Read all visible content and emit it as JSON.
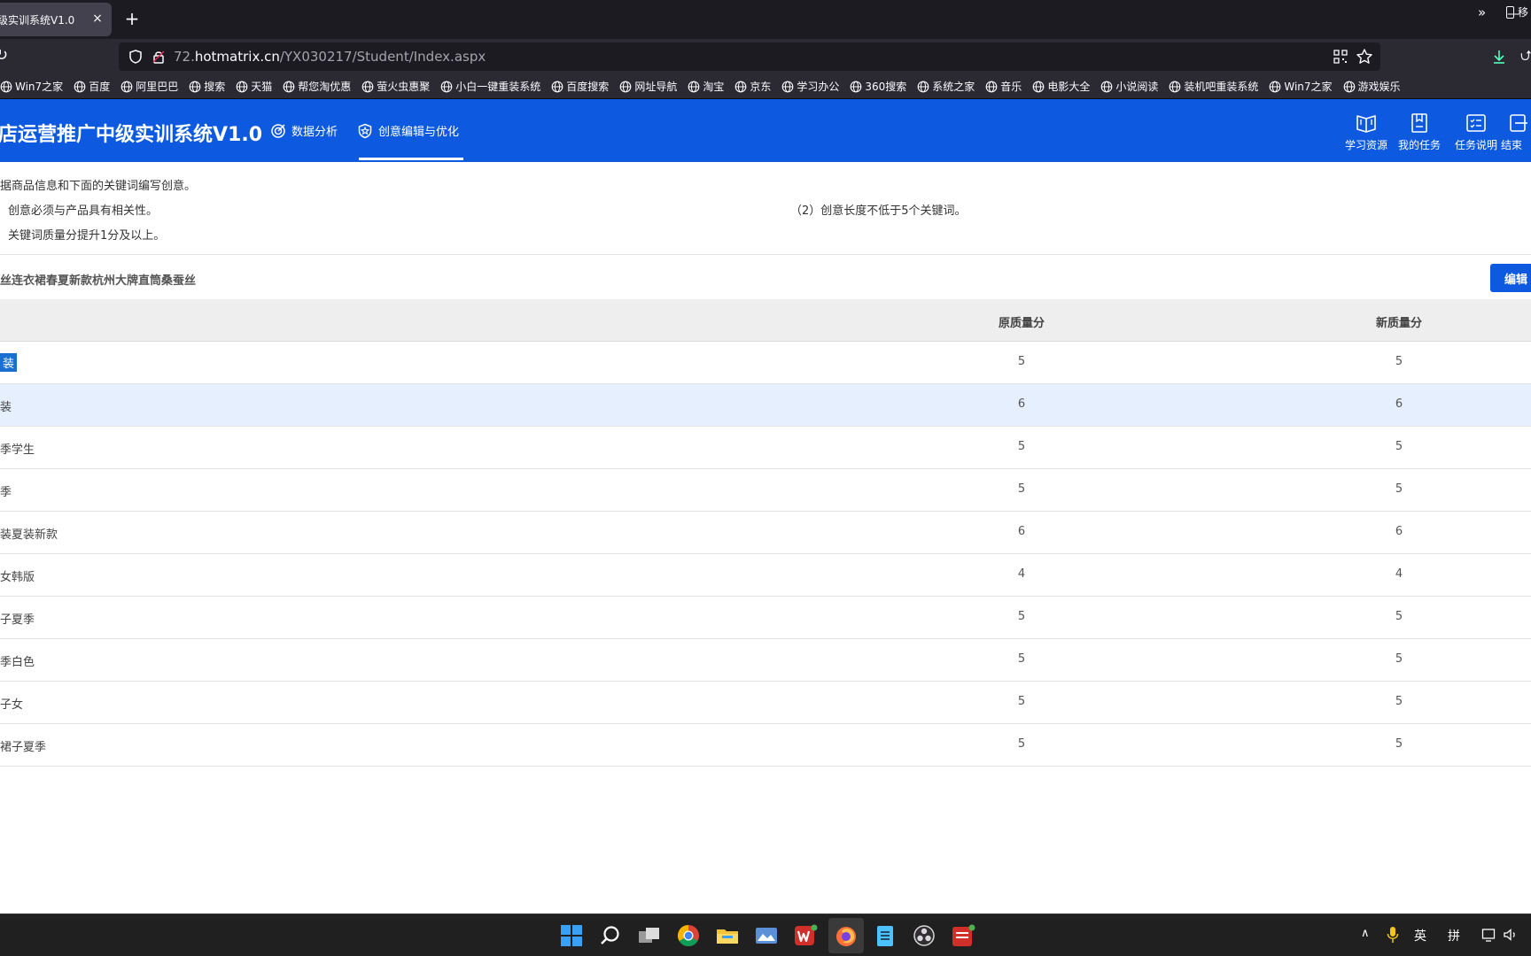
{
  "browser": {
    "tab_title": "级实训系统V1.0",
    "tab_close": "×",
    "new_tab": "+",
    "minimize": "—",
    "url_prefix": "72.",
    "url_host": "hotmatrix.cn",
    "url_path": "/YX030217/Student/Index.aspx",
    "bookmarks": [
      "Win7之家",
      "百度",
      "阿里巴巴",
      "搜索",
      "天猫",
      "帮您淘优惠",
      "萤火虫惠聚",
      "小白一键重装系统",
      "百度搜索",
      "网址导航",
      "淘宝",
      "京东",
      "学习办公",
      "360搜索",
      "系统之家",
      "音乐",
      "电影大全",
      "小说阅读",
      "装机吧重装系统",
      "Win7之家",
      "游戏娱乐"
    ],
    "bookmarks_more": "»",
    "mobile_bookmarks": "移"
  },
  "header": {
    "app_title": "店运营推广中级实训系统V1.0",
    "nav": [
      {
        "label": "数据分析"
      },
      {
        "label": "创意编辑与优化"
      }
    ],
    "right_icons": [
      {
        "label": "学习资源"
      },
      {
        "label": "我的任务"
      },
      {
        "label": "任务说明"
      },
      {
        "label": "结束"
      }
    ]
  },
  "instructions": {
    "line1": "据商品信息和下面的关键词编写创意。",
    "item1": "）创意必须与产品具有相关性。",
    "item2": "（2）创意长度不低于5个关键词。",
    "item3": "）关键词质量分提升1分及以上。"
  },
  "product": {
    "name": "丝连衣裙春夏新款杭州大牌直筒桑蚕丝",
    "edit_label": "编辑"
  },
  "table": {
    "headers": {
      "original": "原质量分",
      "new": "新质量分"
    },
    "rows": [
      {
        "keyword": "装",
        "original": "5",
        "new": "5"
      },
      {
        "keyword": "装",
        "original": "6",
        "new": "6"
      },
      {
        "keyword": "季学生",
        "original": "5",
        "new": "5"
      },
      {
        "keyword": "季",
        "original": "5",
        "new": "5"
      },
      {
        "keyword": "装夏装新款",
        "original": "6",
        "new": "6"
      },
      {
        "keyword": "女韩版",
        "original": "4",
        "new": "4"
      },
      {
        "keyword": "子夏季",
        "original": "5",
        "new": "5"
      },
      {
        "keyword": "季白色",
        "original": "5",
        "new": "5"
      },
      {
        "keyword": "子女",
        "original": "5",
        "new": "5"
      },
      {
        "keyword": "裙子夏季",
        "original": "5",
        "new": "5"
      }
    ]
  },
  "taskbar": {
    "tray_lang1": "英",
    "tray_lang2": "拼"
  }
}
